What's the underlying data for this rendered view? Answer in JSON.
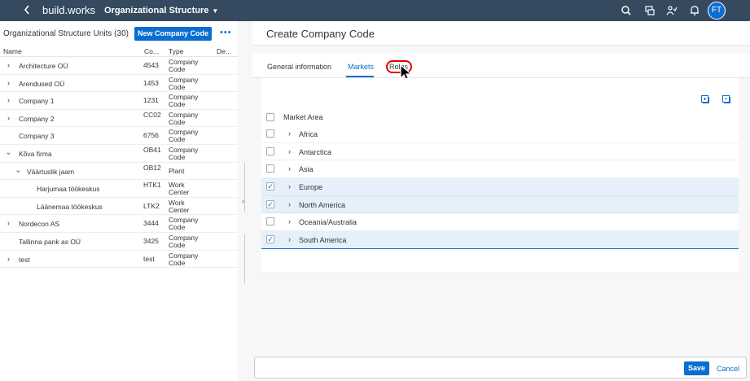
{
  "shell": {
    "back_icon": "chevron-left-icon",
    "brand_prefix": "build.",
    "brand_suffix": "works",
    "app_title": "Organizational Structure",
    "avatar_initials": "FT",
    "bg_color": "#354a5f"
  },
  "left": {
    "title": "Organizational Structure Units (30)",
    "new_button": "New Company Code",
    "more": "•••",
    "columns": {
      "name": "Name",
      "code": "Co...",
      "type": "Type",
      "desc": "De..."
    },
    "rows": [
      {
        "name": "Architecture OÜ",
        "code": "4543",
        "type": "Company Code",
        "expand": "right"
      },
      {
        "name": "Arendused OÜ",
        "code": "1453",
        "type": "Company Code",
        "expand": "right"
      },
      {
        "name": "Company 1",
        "code": "1231",
        "type": "Company Code",
        "expand": "right"
      },
      {
        "name": "Company 2",
        "code": "CC02",
        "type": "Company Code",
        "expand": "right"
      },
      {
        "name": "Company 3",
        "code": "6756",
        "type": "Company Code",
        "expand": "none"
      },
      {
        "name": "Kõva firma",
        "code": "OB41",
        "type": "Company Code",
        "expand": "down"
      },
      {
        "name": "Väärtuslik jaam",
        "code": "OB12",
        "type": "Plant",
        "expand": "down"
      },
      {
        "name": "Harjumaa töökeskus",
        "code": "HTK1",
        "type": "Work Center",
        "expand": "none"
      },
      {
        "name": "Läänemaa töökeskus",
        "code": "LTK2",
        "type": "Work Center",
        "expand": "none"
      },
      {
        "name": "Nordecon AS",
        "code": "3444",
        "type": "Company Code",
        "expand": "right"
      },
      {
        "name": "Tallinna pank as OÜ",
        "code": "3425",
        "type": "Company Code",
        "expand": "none"
      },
      {
        "name": "test",
        "code": "test",
        "type": "Company Code",
        "expand": "right"
      }
    ]
  },
  "right": {
    "title": "Create Company Code",
    "tabs": [
      {
        "label": "General information",
        "active": false
      },
      {
        "label": "Markets",
        "active": true
      },
      {
        "label": "Roles",
        "active": false
      }
    ],
    "markets": {
      "header": "Market Area",
      "rows": [
        {
          "name": "Africa",
          "checked": false
        },
        {
          "name": "Antarctica",
          "checked": false
        },
        {
          "name": "Asia",
          "checked": false
        },
        {
          "name": "Europe",
          "checked": true
        },
        {
          "name": "North America",
          "checked": true
        },
        {
          "name": "Oceania/Australia",
          "checked": false
        },
        {
          "name": "South America",
          "checked": true
        }
      ]
    }
  },
  "footer": {
    "save": "Save",
    "cancel": "Cancel"
  },
  "colors": {
    "accent": "#0a6ed1",
    "selected_row": "#e5f0fa",
    "highlight": "#e00000"
  }
}
